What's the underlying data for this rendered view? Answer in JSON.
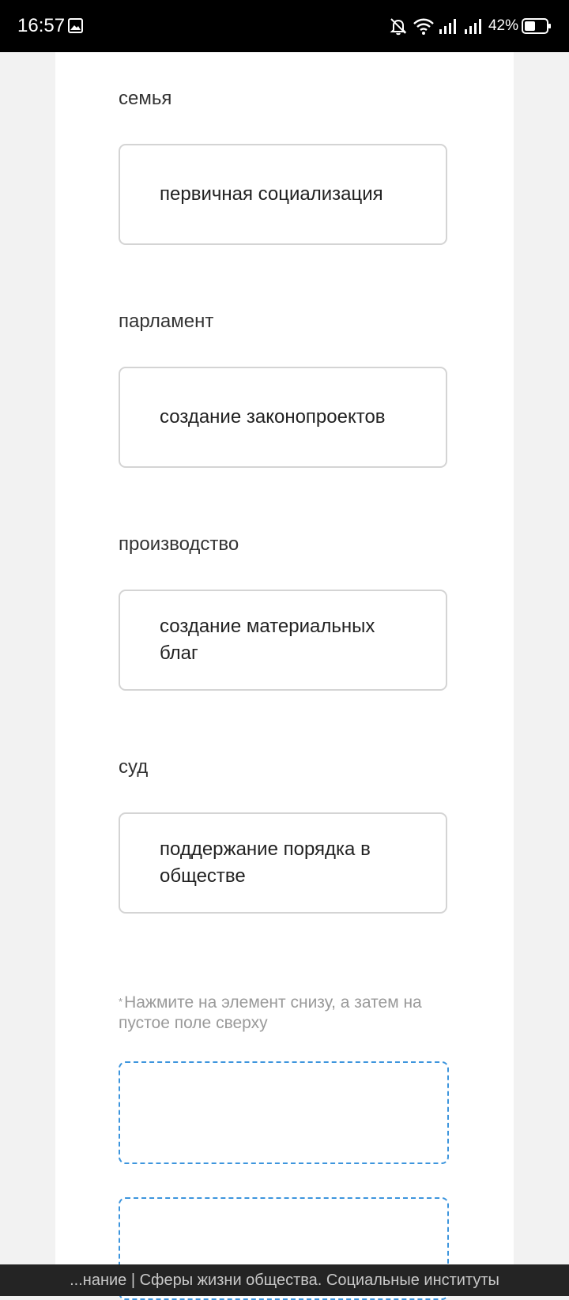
{
  "status_bar": {
    "time": "16:57",
    "battery": "42%",
    "icons": [
      "gallery-icon",
      "bell-muted-icon",
      "wifi-icon",
      "signal-icon",
      "signal-icon",
      "battery-icon"
    ]
  },
  "pairs": [
    {
      "category": "семья",
      "answer": "первичная социализация"
    },
    {
      "category": "парламент",
      "answer": "создание законопроектов"
    },
    {
      "category": "производство",
      "answer": "создание материальных благ"
    },
    {
      "category": "суд",
      "answer": "поддержание порядка в обществе"
    }
  ],
  "hint": {
    "marker": "*",
    "text": "Нажмите на элемент снизу, а затем на пустое поле сверху"
  },
  "page_title": "...нание | Сферы жизни общества. Социальные институты",
  "colors": {
    "dashed_border": "#3d95dd",
    "box_border": "#d4d4d4",
    "hint_text": "#9a9a9a"
  }
}
